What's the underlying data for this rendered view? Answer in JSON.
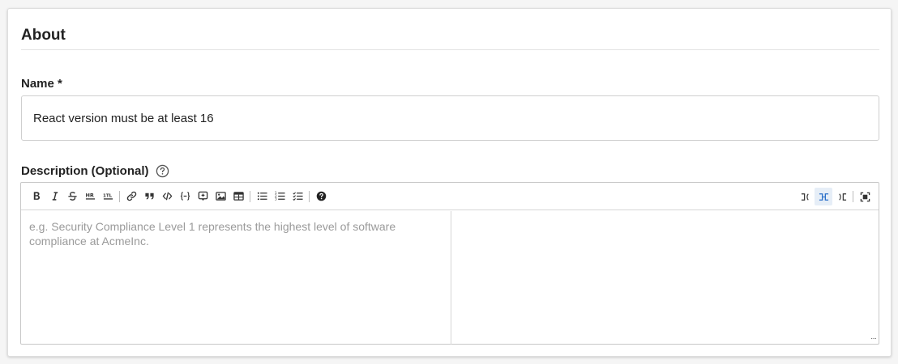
{
  "section": {
    "title": "About"
  },
  "name_field": {
    "label": "Name *",
    "value": "React version must be at least 16"
  },
  "description_field": {
    "label": "Description (Optional)",
    "help_icon": "question-circle-icon",
    "placeholder": "e.g. Security Compliance Level 1 represents the highest level of software compliance at AcmeInc."
  },
  "toolbar": {
    "left_groups": [
      [
        "bold-icon",
        "italic-icon",
        "strikethrough-icon",
        "horizontal-rule-icon",
        "heading-icon"
      ],
      [
        "link-icon",
        "quote-icon",
        "code-icon",
        "code-block-icon",
        "comment-icon",
        "image-icon",
        "table-icon"
      ],
      [
        "unordered-list-icon",
        "ordered-list-icon",
        "checklist-icon"
      ],
      [
        "help-icon"
      ]
    ],
    "right_buttons": [
      "editor-only-icon",
      "split-view-icon",
      "preview-only-icon",
      "fullscreen-icon"
    ],
    "active_right": "split-view-icon"
  },
  "colors": {
    "accent": "#2a6fc9",
    "border": "#cfcfcf",
    "placeholder": "#9a9a9a"
  }
}
